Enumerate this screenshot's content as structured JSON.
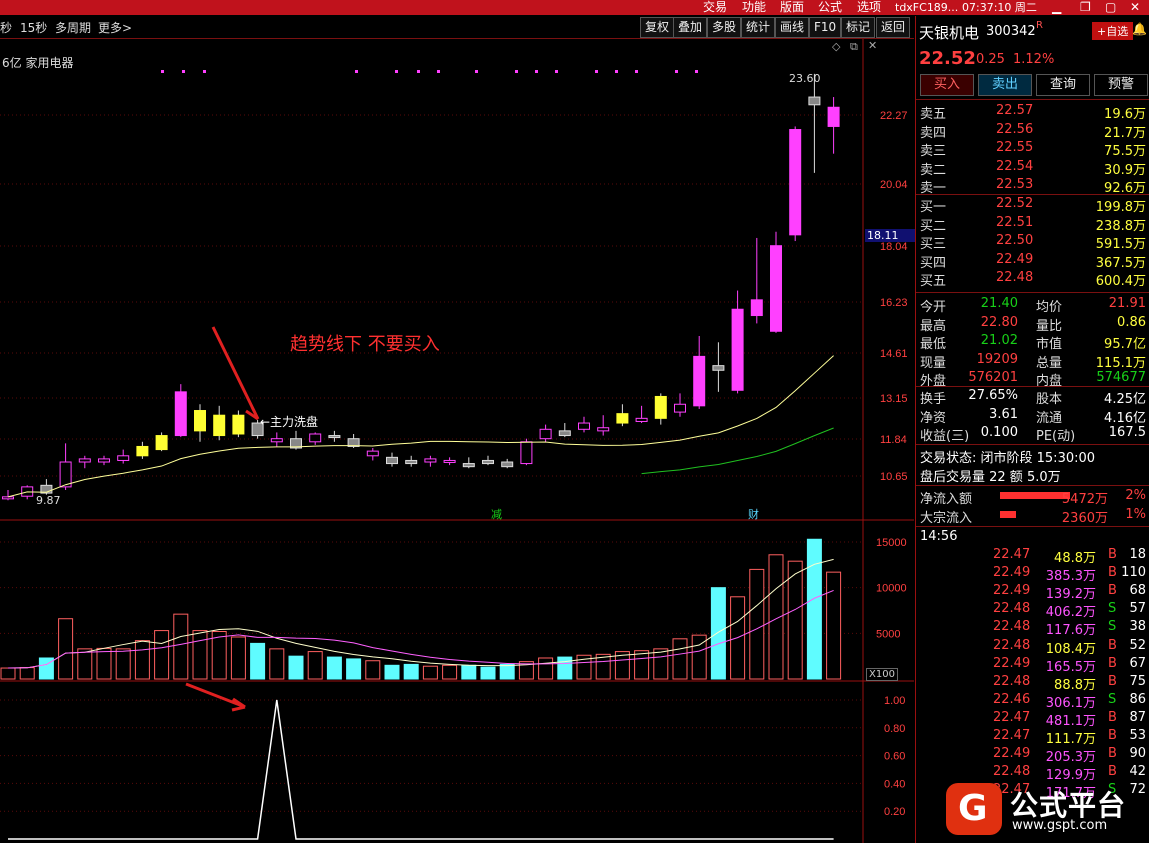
{
  "topbar": {
    "menus": [
      "交易",
      "功能",
      "版面",
      "公式",
      "选项"
    ],
    "server": "tdxFC189...",
    "time": "07:37:10 周二"
  },
  "toolbar": {
    "items": [
      "秒",
      "15秒",
      "多周期",
      "更多>"
    ],
    "right_buttons": [
      "复权",
      "叠加",
      "多股",
      "统计",
      "画线",
      "F10",
      "标记",
      "返回"
    ],
    "board_label": "6亿 家用电器"
  },
  "price_axis": [
    "22.27",
    "20.04",
    "18.04",
    "16.23",
    "14.61",
    "13.15",
    "11.84",
    "10.65"
  ],
  "price_marker": "18.11",
  "high_label": "23.60",
  "low_label": "9.87",
  "annotation_main": "趋势线下 不要买入",
  "annotation_wash": "←主力洗盘",
  "event_labels": [
    "减",
    "财"
  ],
  "vol_axis": [
    "15000",
    "10000",
    "5000"
  ],
  "vol_unit": "X100",
  "ind_axis": [
    "1.00",
    "0.80",
    "0.60",
    "0.40",
    "0.20"
  ],
  "stock": {
    "name": "天银机电",
    "code": "300342",
    "flag": "R",
    "add_fav": "+自选",
    "price": "22.52",
    "change": "0.25",
    "pct": "1.12%",
    "buttons": [
      "买入",
      "卖出",
      "查询",
      "预警"
    ]
  },
  "asks": [
    {
      "label": "卖五",
      "price": "22.57",
      "vol": "19.6万"
    },
    {
      "label": "卖四",
      "price": "22.56",
      "vol": "21.7万"
    },
    {
      "label": "卖三",
      "price": "22.55",
      "vol": "75.5万"
    },
    {
      "label": "卖二",
      "price": "22.54",
      "vol": "30.9万"
    },
    {
      "label": "卖一",
      "price": "22.53",
      "vol": "92.6万"
    }
  ],
  "bids": [
    {
      "label": "买一",
      "price": "22.52",
      "vol": "199.8万"
    },
    {
      "label": "买二",
      "price": "22.51",
      "vol": "238.8万"
    },
    {
      "label": "买三",
      "price": "22.50",
      "vol": "591.5万"
    },
    {
      "label": "买四",
      "price": "22.49",
      "vol": "367.5万"
    },
    {
      "label": "买五",
      "price": "22.48",
      "vol": "600.4万"
    }
  ],
  "stats": [
    {
      "l1": "今开",
      "v1": "21.40",
      "l2": "均价",
      "v2": "21.91"
    },
    {
      "l1": "最高",
      "v1": "22.80",
      "l2": "量比",
      "v2": "0.86"
    },
    {
      "l1": "最低",
      "v1": "21.02",
      "l2": "市值",
      "v2": "95.7亿"
    },
    {
      "l1": "现量",
      "v1": "19209",
      "l2": "总量",
      "v2": "115.1万"
    },
    {
      "l1": "外盘",
      "v1": "576201",
      "l2": "内盘",
      "v2": "574677"
    }
  ],
  "stats2": [
    {
      "l1": "换手",
      "v1": "27.65%",
      "l2": "股本",
      "v2": "4.25亿"
    },
    {
      "l1": "净资",
      "v1": "3.61",
      "l2": "流通",
      "v2": "4.16亿"
    },
    {
      "l1": "收益(三)",
      "v1": "0.100",
      "l2": "PE(动)",
      "v2": "167.5"
    }
  ],
  "trade_status": "交易状态: 闭市阶段 15:30:00",
  "after_hours": "盘后交易量 22 额 5.0万",
  "flows": [
    {
      "label": "净流入额",
      "value": "5472万",
      "pct": "2%"
    },
    {
      "label": "大宗流入",
      "value": "2360万",
      "pct": "1%"
    }
  ],
  "ticks_time": "14:56",
  "ticks": [
    {
      "p": "22.47",
      "v": "48.8万",
      "s": "B",
      "n": "18"
    },
    {
      "p": "22.49",
      "v": "385.3万",
      "s": "B",
      "n": "110"
    },
    {
      "p": "22.49",
      "v": "139.2万",
      "s": "B",
      "n": "68"
    },
    {
      "p": "22.48",
      "v": "406.2万",
      "s": "S",
      "n": "57"
    },
    {
      "p": "22.48",
      "v": "117.6万",
      "s": "S",
      "n": "38"
    },
    {
      "p": "22.48",
      "v": "108.4万",
      "s": "B",
      "n": "52"
    },
    {
      "p": "22.49",
      "v": "165.5万",
      "s": "B",
      "n": "67"
    },
    {
      "p": "22.48",
      "v": "88.8万",
      "s": "B",
      "n": "75"
    },
    {
      "p": "22.46",
      "v": "306.1万",
      "s": "S",
      "n": "86"
    },
    {
      "p": "22.47",
      "v": "481.1万",
      "s": "B",
      "n": "87"
    },
    {
      "p": "22.47",
      "v": "111.7万",
      "s": "B",
      "n": "53"
    },
    {
      "p": "22.49",
      "v": "205.3万",
      "s": "B",
      "n": "90"
    },
    {
      "p": "22.48",
      "v": "129.9万",
      "s": "B",
      "n": "42"
    },
    {
      "p": "22.47",
      "v": "171.7万",
      "s": "S",
      "n": "72"
    }
  ],
  "watermark": {
    "brand": "公式平台",
    "url": "www.gspt.com"
  },
  "colors": {
    "up": "#ff40ff",
    "down": "#5ffcff",
    "yellow": "#ffff33",
    "frame": "#9a1010"
  },
  "chart_data": {
    "type": "candlestick",
    "candles": [
      {
        "o": 9.95,
        "h": 10.2,
        "l": 9.87,
        "c": 9.98
      },
      {
        "o": 10.0,
        "h": 10.35,
        "l": 9.9,
        "c": 10.3
      },
      {
        "o": 10.35,
        "h": 10.55,
        "l": 10.05,
        "c": 10.1
      },
      {
        "o": 10.3,
        "h": 11.7,
        "l": 10.2,
        "c": 11.1
      },
      {
        "o": 11.1,
        "h": 11.3,
        "l": 10.9,
        "c": 11.2
      },
      {
        "o": 11.1,
        "h": 11.3,
        "l": 11.0,
        "c": 11.2
      },
      {
        "o": 11.15,
        "h": 11.5,
        "l": 11.05,
        "c": 11.3
      },
      {
        "o": 11.3,
        "h": 11.75,
        "l": 11.2,
        "c": 11.6
      },
      {
        "o": 11.5,
        "h": 12.05,
        "l": 11.45,
        "c": 11.95
      },
      {
        "o": 11.95,
        "h": 13.6,
        "l": 11.9,
        "c": 13.35
      },
      {
        "o": 12.1,
        "h": 12.95,
        "l": 11.75,
        "c": 12.75
      },
      {
        "o": 11.95,
        "h": 12.9,
        "l": 11.8,
        "c": 12.6
      },
      {
        "o": 12.0,
        "h": 12.75,
        "l": 11.9,
        "c": 12.6
      },
      {
        "o": 12.35,
        "h": 12.45,
        "l": 11.85,
        "c": 11.95
      },
      {
        "o": 11.75,
        "h": 12.05,
        "l": 11.6,
        "c": 11.85
      },
      {
        "o": 11.85,
        "h": 12.1,
        "l": 11.5,
        "c": 11.55
      },
      {
        "o": 11.75,
        "h": 12.05,
        "l": 11.65,
        "c": 12.0
      },
      {
        "o": 11.95,
        "h": 12.1,
        "l": 11.75,
        "c": 11.9
      },
      {
        "o": 11.85,
        "h": 12.0,
        "l": 11.55,
        "c": 11.6
      },
      {
        "o": 11.3,
        "h": 11.55,
        "l": 11.15,
        "c": 11.45
      },
      {
        "o": 11.25,
        "h": 11.4,
        "l": 10.95,
        "c": 11.05
      },
      {
        "o": 11.15,
        "h": 11.3,
        "l": 10.95,
        "c": 11.05
      },
      {
        "o": 11.1,
        "h": 11.3,
        "l": 10.95,
        "c": 11.2
      },
      {
        "o": 11.15,
        "h": 11.25,
        "l": 11.0,
        "c": 11.15
      },
      {
        "o": 11.05,
        "h": 11.25,
        "l": 10.9,
        "c": 10.95
      },
      {
        "o": 11.15,
        "h": 11.3,
        "l": 11.0,
        "c": 11.05
      },
      {
        "o": 11.1,
        "h": 11.2,
        "l": 10.9,
        "c": 10.95
      },
      {
        "o": 11.05,
        "h": 11.85,
        "l": 11.0,
        "c": 11.75
      },
      {
        "o": 11.85,
        "h": 12.3,
        "l": 11.75,
        "c": 12.15
      },
      {
        "o": 12.1,
        "h": 12.35,
        "l": 11.9,
        "c": 11.95
      },
      {
        "o": 12.15,
        "h": 12.55,
        "l": 12.05,
        "c": 12.35
      },
      {
        "o": 12.1,
        "h": 12.6,
        "l": 11.95,
        "c": 12.2
      },
      {
        "o": 12.35,
        "h": 12.95,
        "l": 12.25,
        "c": 12.65
      },
      {
        "o": 12.4,
        "h": 12.9,
        "l": 12.35,
        "c": 12.5
      },
      {
        "o": 12.5,
        "h": 13.3,
        "l": 12.3,
        "c": 13.2
      },
      {
        "o": 12.7,
        "h": 13.3,
        "l": 12.55,
        "c": 12.95
      },
      {
        "o": 12.9,
        "h": 15.15,
        "l": 12.8,
        "c": 14.5
      },
      {
        "o": 14.2,
        "h": 14.95,
        "l": 13.35,
        "c": 14.05
      },
      {
        "o": 13.4,
        "h": 16.6,
        "l": 13.3,
        "c": 16.0
      },
      {
        "o": 15.8,
        "h": 18.3,
        "l": 15.55,
        "c": 16.3
      },
      {
        "o": 15.3,
        "h": 18.5,
        "l": 15.25,
        "c": 18.05
      },
      {
        "o": 18.4,
        "h": 21.9,
        "l": 18.2,
        "c": 21.8
      },
      {
        "o": 22.85,
        "h": 23.6,
        "l": 20.4,
        "c": 22.6
      },
      {
        "o": 21.9,
        "h": 22.85,
        "l": 21.02,
        "c": 22.52
      }
    ],
    "volume": [
      1200,
      1250,
      2300,
      6600,
      3300,
      3350,
      3300,
      4200,
      5300,
      7100,
      5300,
      5200,
      4600,
      3900,
      3300,
      2500,
      3000,
      2400,
      2200,
      2000,
      1500,
      1600,
      1400,
      1500,
      1500,
      1300,
      1600,
      1900,
      2300,
      2400,
      2600,
      2700,
      3000,
      3100,
      3300,
      4400,
      4800,
      10000,
      9000,
      12000,
      13600,
      12900,
      15300,
      11700
    ],
    "ind": [
      0,
      0,
      0,
      0,
      0,
      0,
      0,
      0,
      0,
      0,
      0,
      0,
      0,
      0,
      1,
      0,
      0,
      0,
      0,
      0,
      0,
      0,
      0,
      0,
      0,
      0,
      0,
      0,
      0,
      0,
      0,
      0,
      0,
      0,
      0,
      0,
      0,
      0,
      0,
      0,
      0,
      0,
      0,
      0
    ]
  }
}
